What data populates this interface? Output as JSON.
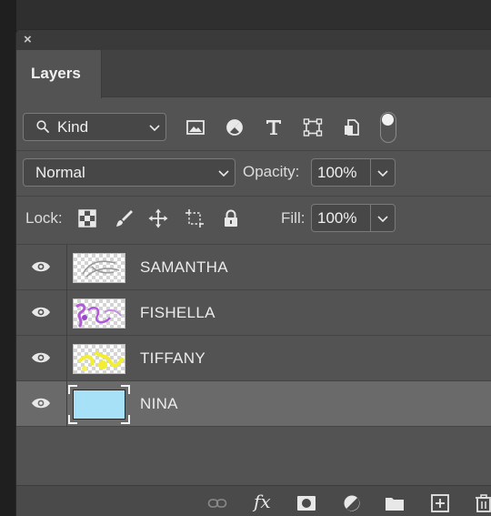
{
  "panel": {
    "close_symbol": "×",
    "tab_label": "Layers"
  },
  "filter": {
    "kind_label": "Kind",
    "icons": [
      "image-filter-icon",
      "adjustment-filter-icon",
      "type-filter-icon",
      "shape-filter-icon",
      "smart-object-filter-icon"
    ]
  },
  "blend": {
    "mode": "Normal",
    "opacity_label": "Opacity:",
    "opacity_value": "100%"
  },
  "lock": {
    "label": "Lock:",
    "fill_label": "Fill:",
    "fill_value": "100%"
  },
  "layers": [
    {
      "name": "SAMANTHA",
      "visible": true,
      "selected": false
    },
    {
      "name": "FISHELLA",
      "visible": true,
      "selected": false
    },
    {
      "name": "TIFFANY",
      "visible": true,
      "selected": false
    },
    {
      "name": "NINA",
      "visible": true,
      "selected": true
    }
  ],
  "footer": {
    "icons": [
      "link-layers-icon",
      "fx-icon",
      "mask-icon",
      "adjustment-icon",
      "folder-icon",
      "new-layer-icon",
      "trash-icon"
    ],
    "fx_text": "fx"
  },
  "colors": {
    "panel_bg": "#535353",
    "selected_row": "#6a6a6a",
    "nina_fill": "#a6e1f7",
    "fishella_purple": "#b05bd8",
    "tiffany_yellow": "#f3ee2f"
  }
}
